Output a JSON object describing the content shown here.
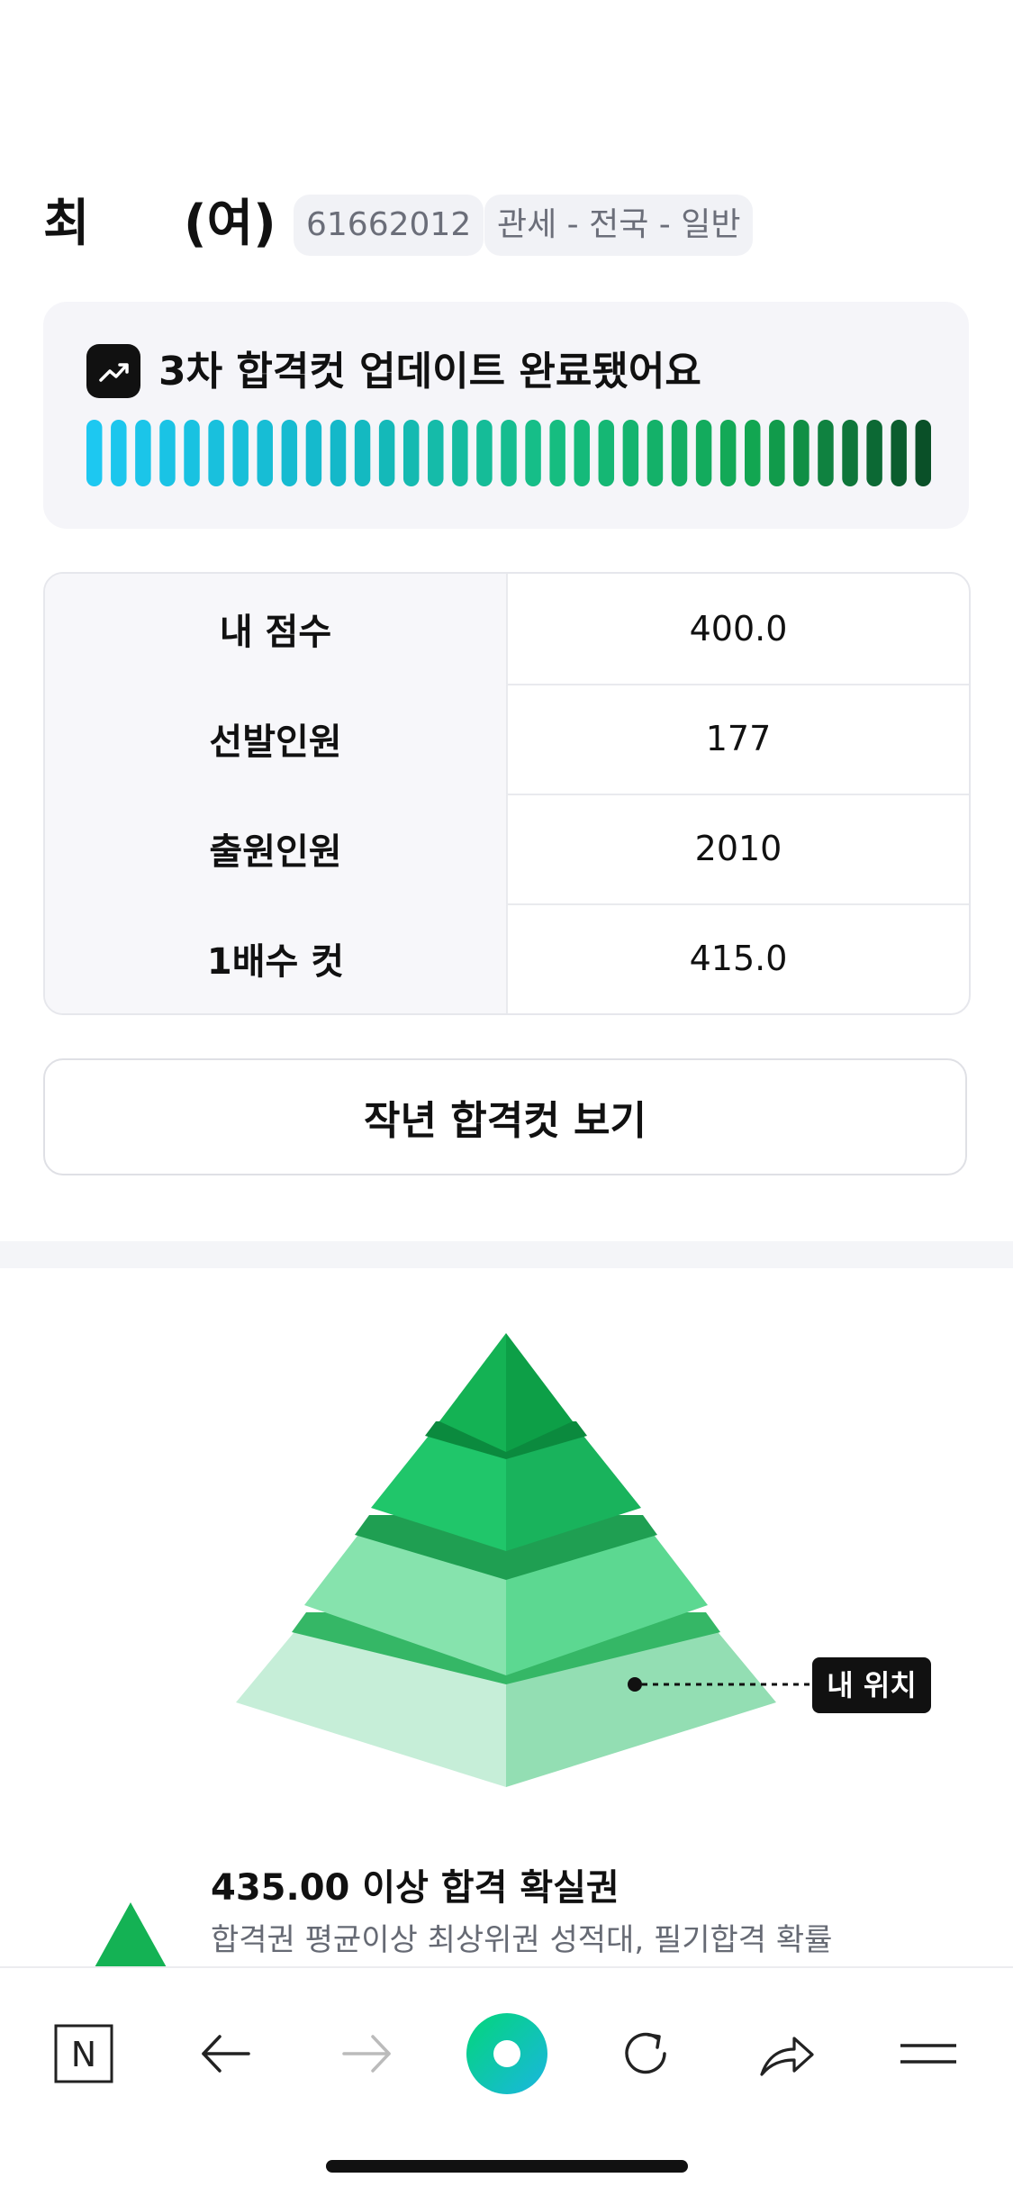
{
  "header": {
    "name_first": "최",
    "name_suffix": "(여)",
    "exam_number": "61662012",
    "category": "관세 - 전국 - 일반"
  },
  "update_card": {
    "icon": "trending-up-icon",
    "title": "3차 합격컷 업데이트 완료됐어요",
    "progress": 1.0
  },
  "stats": [
    {
      "label": "내 점수",
      "value": "400.0"
    },
    {
      "label": "선발인원",
      "value": "177"
    },
    {
      "label": "출원인원",
      "value": "2010"
    },
    {
      "label": "1배수 컷",
      "value": "415.0"
    }
  ],
  "cta": {
    "label": "작년 합격컷 보기"
  },
  "pyramid": {
    "marker_label": "내 위치",
    "colors": {
      "tier1_left": "#14b254",
      "tier1_right": "#0d9f47",
      "tier2_left": "#20c66a",
      "tier2_right": "#19b35c",
      "tier3_left": "#86e3ad",
      "tier3_right": "#5cd891",
      "tier4_left": "#c6eed8",
      "tier4_right": "#93deb3"
    }
  },
  "tier": {
    "title": "435.00 이상 합격 확실권",
    "description": "합격권 평균이상 최상위권 성적대, 필기합격 확률"
  },
  "toolbar": {
    "items": [
      "n-logo-icon",
      "back-arrow-icon",
      "forward-arrow-icon",
      "green-dot-icon",
      "refresh-icon",
      "share-icon",
      "menu-icon"
    ]
  }
}
